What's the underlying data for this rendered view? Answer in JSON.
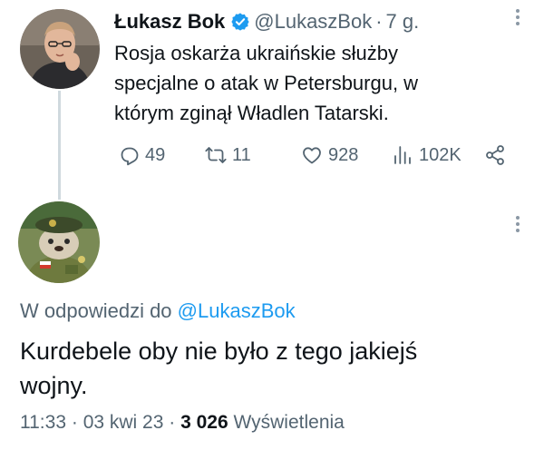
{
  "parent_tweet": {
    "author_name": "Łukasz Bok",
    "handle": "@LukaszBok",
    "separator": "·",
    "time": "7 g.",
    "text": "Rosja oskarża ukraińskie służby\nspecjalne o atak w Petersburgu, w\nktórym zginął Władlen Tatarski.",
    "verified_icon": "verified-badge-icon",
    "colors": {
      "verified": "#1d9bf0"
    },
    "actions": {
      "replies": "49",
      "retweets": "11",
      "likes": "928",
      "views": "102K"
    }
  },
  "reply_tweet": {
    "reply_context_prefix": "W odpowiedzi do",
    "reply_context_mention": "@LukaszBok",
    "text": "Kurdebele oby nie było z tego jakiejś\nwojny.",
    "meta": {
      "time": "11:33",
      "sep1": "·",
      "date": "03 kwi 23",
      "sep2": "·",
      "views_count": "3 026",
      "views_label": "Wyświetlenia"
    }
  },
  "icons": [
    "more-icon",
    "reply-icon",
    "retweet-icon",
    "like-icon",
    "views-icon",
    "share-icon"
  ],
  "colors": {
    "text": "#0f1419",
    "secondary": "#536471",
    "link": "#1d9bf0",
    "thread_line": "#cfd9de"
  }
}
